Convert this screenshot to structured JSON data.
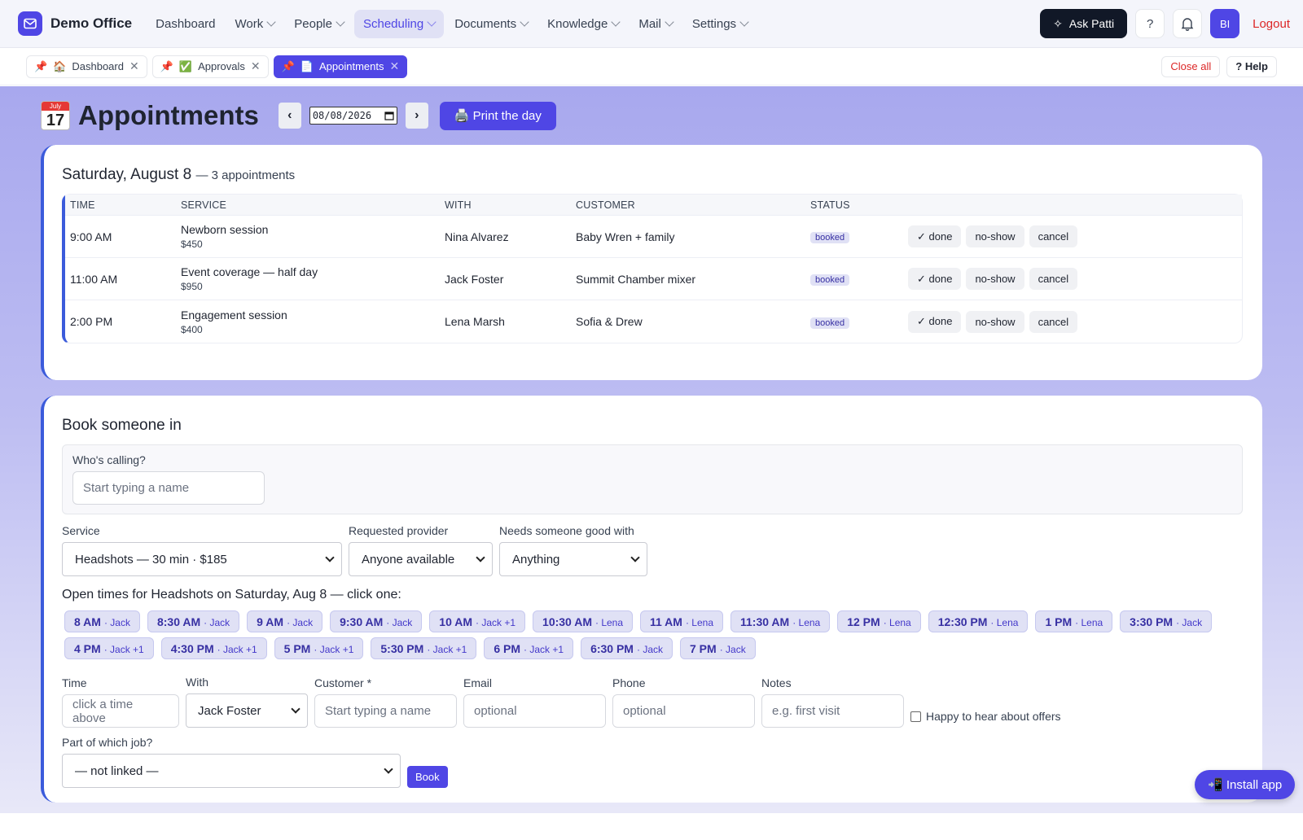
{
  "app": {
    "brand": "Demo Office"
  },
  "nav": {
    "items": [
      {
        "label": "Dashboard",
        "has_menu": false
      },
      {
        "label": "Work",
        "has_menu": true
      },
      {
        "label": "People",
        "has_menu": true
      },
      {
        "label": "Scheduling",
        "has_menu": true,
        "active": true
      },
      {
        "label": "Documents",
        "has_menu": true
      },
      {
        "label": "Knowledge",
        "has_menu": true
      },
      {
        "label": "Mail",
        "has_menu": true
      },
      {
        "label": "Settings",
        "has_menu": true
      }
    ],
    "ask_label": "Ask Patti",
    "help_label": "?",
    "avatar_initials": "BI",
    "logout_label": "Logout"
  },
  "tabs": {
    "items": [
      {
        "pin": "📌",
        "icon": "🏠",
        "label": "Dashboard",
        "close": "✕"
      },
      {
        "pin": "📌",
        "icon": "✅",
        "label": "Approvals",
        "close": "✕"
      },
      {
        "pin": "📌",
        "icon": "📄",
        "label": "Appointments",
        "close": "✕",
        "active": true
      }
    ],
    "close_all": "Close all",
    "help": "? Help"
  },
  "page": {
    "calendar_month": "July",
    "calendar_day": "17",
    "title": "Appointments",
    "prev": "‹",
    "next": "›",
    "date_value": "08/08/2026",
    "print_label": "🖨️ Print the day"
  },
  "day": {
    "heading": "Saturday, August 8",
    "count": "— 3 appointments",
    "columns": [
      "TIME",
      "SERVICE",
      "WITH",
      "CUSTOMER",
      "STATUS",
      ""
    ],
    "rows": [
      {
        "time": "9:00 AM",
        "service": "Newborn session",
        "price": "$450",
        "with": "Nina Alvarez",
        "customer": "Baby Wren + family",
        "status": "booked"
      },
      {
        "time": "11:00 AM",
        "service": "Event coverage — half day",
        "price": "$950",
        "with": "Jack Foster",
        "customer": "Summit Chamber mixer",
        "status": "booked"
      },
      {
        "time": "2:00 PM",
        "service": "Engagement session",
        "price": "$400",
        "with": "Lena Marsh",
        "customer": "Sofia & Drew",
        "status": "booked"
      }
    ],
    "actions": {
      "done": "✓ done",
      "noshow": "no-show",
      "cancel": "cancel"
    }
  },
  "book": {
    "heading": "Book someone in",
    "caller_label": "Who's calling?",
    "caller_placeholder": "Start typing a name",
    "service_label": "Service",
    "service_value": "Headshots — 30 min · $185",
    "provider_label": "Requested provider",
    "provider_value": "Anyone available",
    "skill_label": "Needs someone good with",
    "skill_value": "Anything",
    "open_heading": "Open times for Headshots on Saturday, Aug 8 — click one:",
    "slots": [
      {
        "t": "8 AM",
        "w": "· Jack"
      },
      {
        "t": "8:30 AM",
        "w": "· Jack"
      },
      {
        "t": "9 AM",
        "w": "· Jack"
      },
      {
        "t": "9:30 AM",
        "w": "· Jack"
      },
      {
        "t": "10 AM",
        "w": "· Jack +1"
      },
      {
        "t": "10:30 AM",
        "w": "· Lena"
      },
      {
        "t": "11 AM",
        "w": "· Lena"
      },
      {
        "t": "11:30 AM",
        "w": "· Lena"
      },
      {
        "t": "12 PM",
        "w": "· Lena"
      },
      {
        "t": "12:30 PM",
        "w": "· Lena"
      },
      {
        "t": "1 PM",
        "w": "· Lena"
      },
      {
        "t": "3:30 PM",
        "w": "· Jack"
      },
      {
        "t": "4 PM",
        "w": "· Jack +1"
      },
      {
        "t": "4:30 PM",
        "w": "· Jack +1"
      },
      {
        "t": "5 PM",
        "w": "· Jack +1"
      },
      {
        "t": "5:30 PM",
        "w": "· Jack +1"
      },
      {
        "t": "6 PM",
        "w": "· Jack +1"
      },
      {
        "t": "6:30 PM",
        "w": "· Jack"
      },
      {
        "t": "7 PM",
        "w": "· Jack"
      }
    ],
    "time_label": "Time",
    "time_placeholder": "click a time above",
    "with_label": "With",
    "with_value": "Jack Foster",
    "customer_label": "Customer *",
    "customer_placeholder": "Start typing a name",
    "email_label": "Email",
    "email_placeholder": "optional",
    "phone_label": "Phone",
    "phone_placeholder": "optional",
    "notes_label": "Notes",
    "notes_placeholder": "e.g. first visit",
    "offers_label": "Happy to hear about offers",
    "job_label": "Part of which job?",
    "job_value": "— not linked —",
    "book_label": "Book"
  },
  "install_label": "📲 Install app",
  "colors": {
    "accent": "#4f46e5",
    "danger": "#dc2626",
    "bar": "#3b5bdb"
  }
}
